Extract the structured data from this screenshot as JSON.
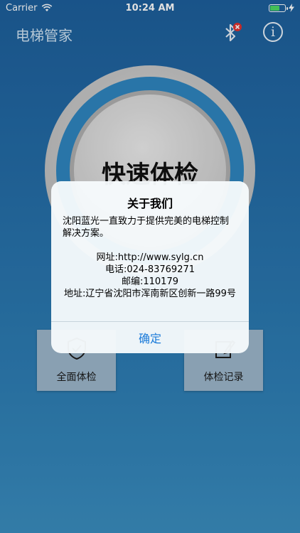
{
  "status_bar": {
    "carrier": "Carrier",
    "time": "10:24 AM",
    "battery_fill_fraction": 0.7
  },
  "nav": {
    "title": "电梯管家",
    "bluetooth_icon": "bluetooth-disconnected-icon",
    "info_icon": "info-icon",
    "info_glyph": "i"
  },
  "main": {
    "quick_check_label": "快速体检"
  },
  "tiles": [
    {
      "label": "全面体检",
      "icon": "shield-check-icon"
    },
    {
      "label": "体检记录",
      "icon": "edit-record-icon"
    }
  ],
  "dialog": {
    "title": "关于我们",
    "intro": "沈阳蓝光一直致力于提供完美的电梯控制解决方案。",
    "website": "网址:http://www.sylg.cn",
    "phone": "电话:024-83769271",
    "postcode": "邮编:110179",
    "address": "地址:辽宁省沈阳市浑南新区创新一路99号",
    "confirm_label": "确定"
  },
  "colors": {
    "accent": "#1a7ad9",
    "background_top": "#1d5f9c",
    "background_bottom": "#3a8dbf",
    "bluetooth_badge": "#e0312f",
    "battery_green": "#4cd964"
  }
}
